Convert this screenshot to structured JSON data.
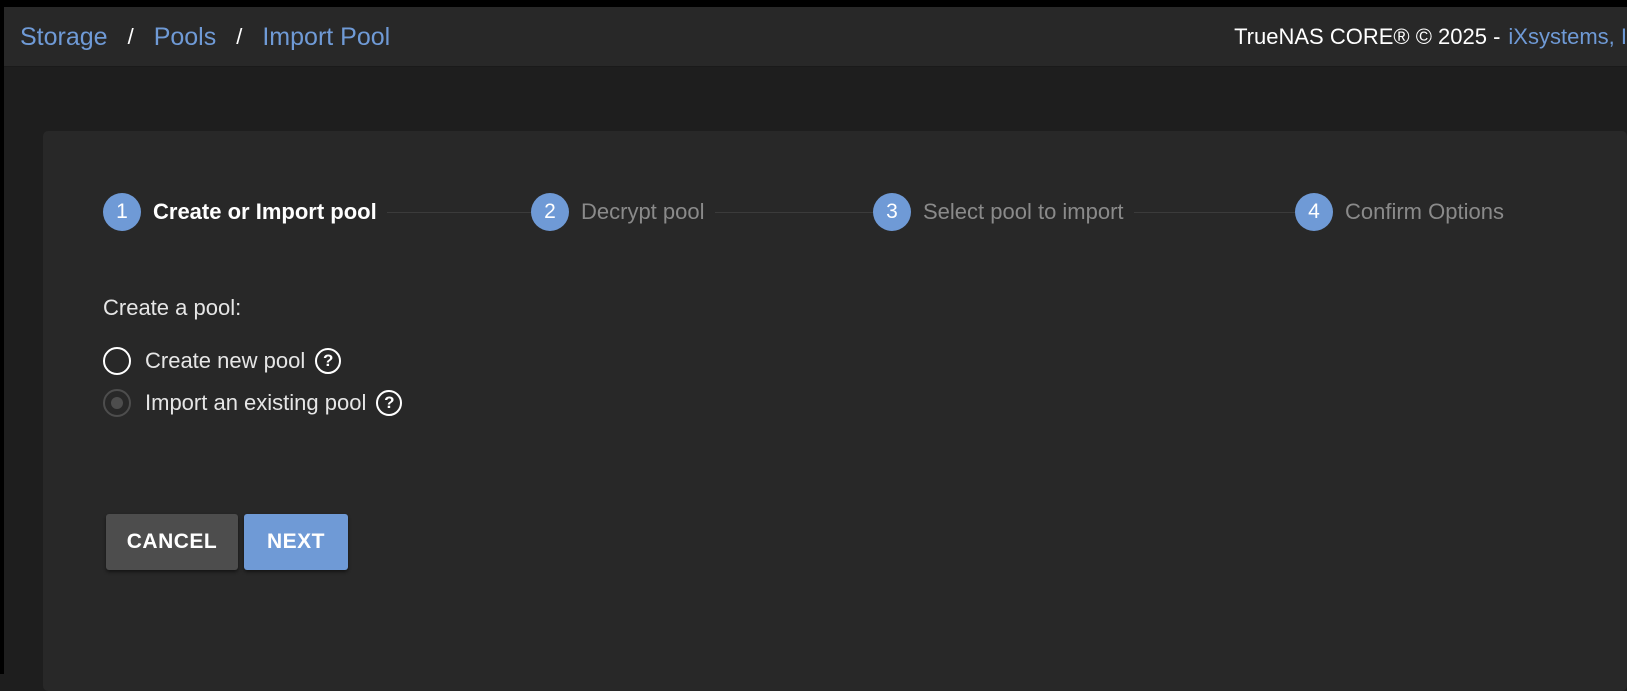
{
  "breadcrumb": {
    "items": [
      "Storage",
      "Pools",
      "Import Pool"
    ],
    "separator": "/"
  },
  "copyright": {
    "text": "TrueNAS CORE® © 2025 -",
    "vendor": "iXsystems, I"
  },
  "stepper": {
    "steps": [
      {
        "number": "1",
        "label": "Create or Import pool",
        "active": true
      },
      {
        "number": "2",
        "label": "Decrypt pool",
        "active": false
      },
      {
        "number": "3",
        "label": "Select pool to import",
        "active": false
      },
      {
        "number": "4",
        "label": "Confirm Options",
        "active": false
      }
    ]
  },
  "form": {
    "section_label": "Create a pool:",
    "options": [
      {
        "label": "Create new pool",
        "checked": false
      },
      {
        "label": "Import an existing pool",
        "checked": true
      }
    ],
    "help_glyph": "?"
  },
  "actions": {
    "cancel_label": "CANCEL",
    "next_label": "NEXT"
  },
  "colors": {
    "accent": "#6f9ad6",
    "background": "#1e1e1e",
    "surface": "#282828",
    "button_secondary": "#4d4d4d"
  },
  "icons": {
    "help": "help-circle-icon",
    "radio": "radio-button-icon"
  }
}
